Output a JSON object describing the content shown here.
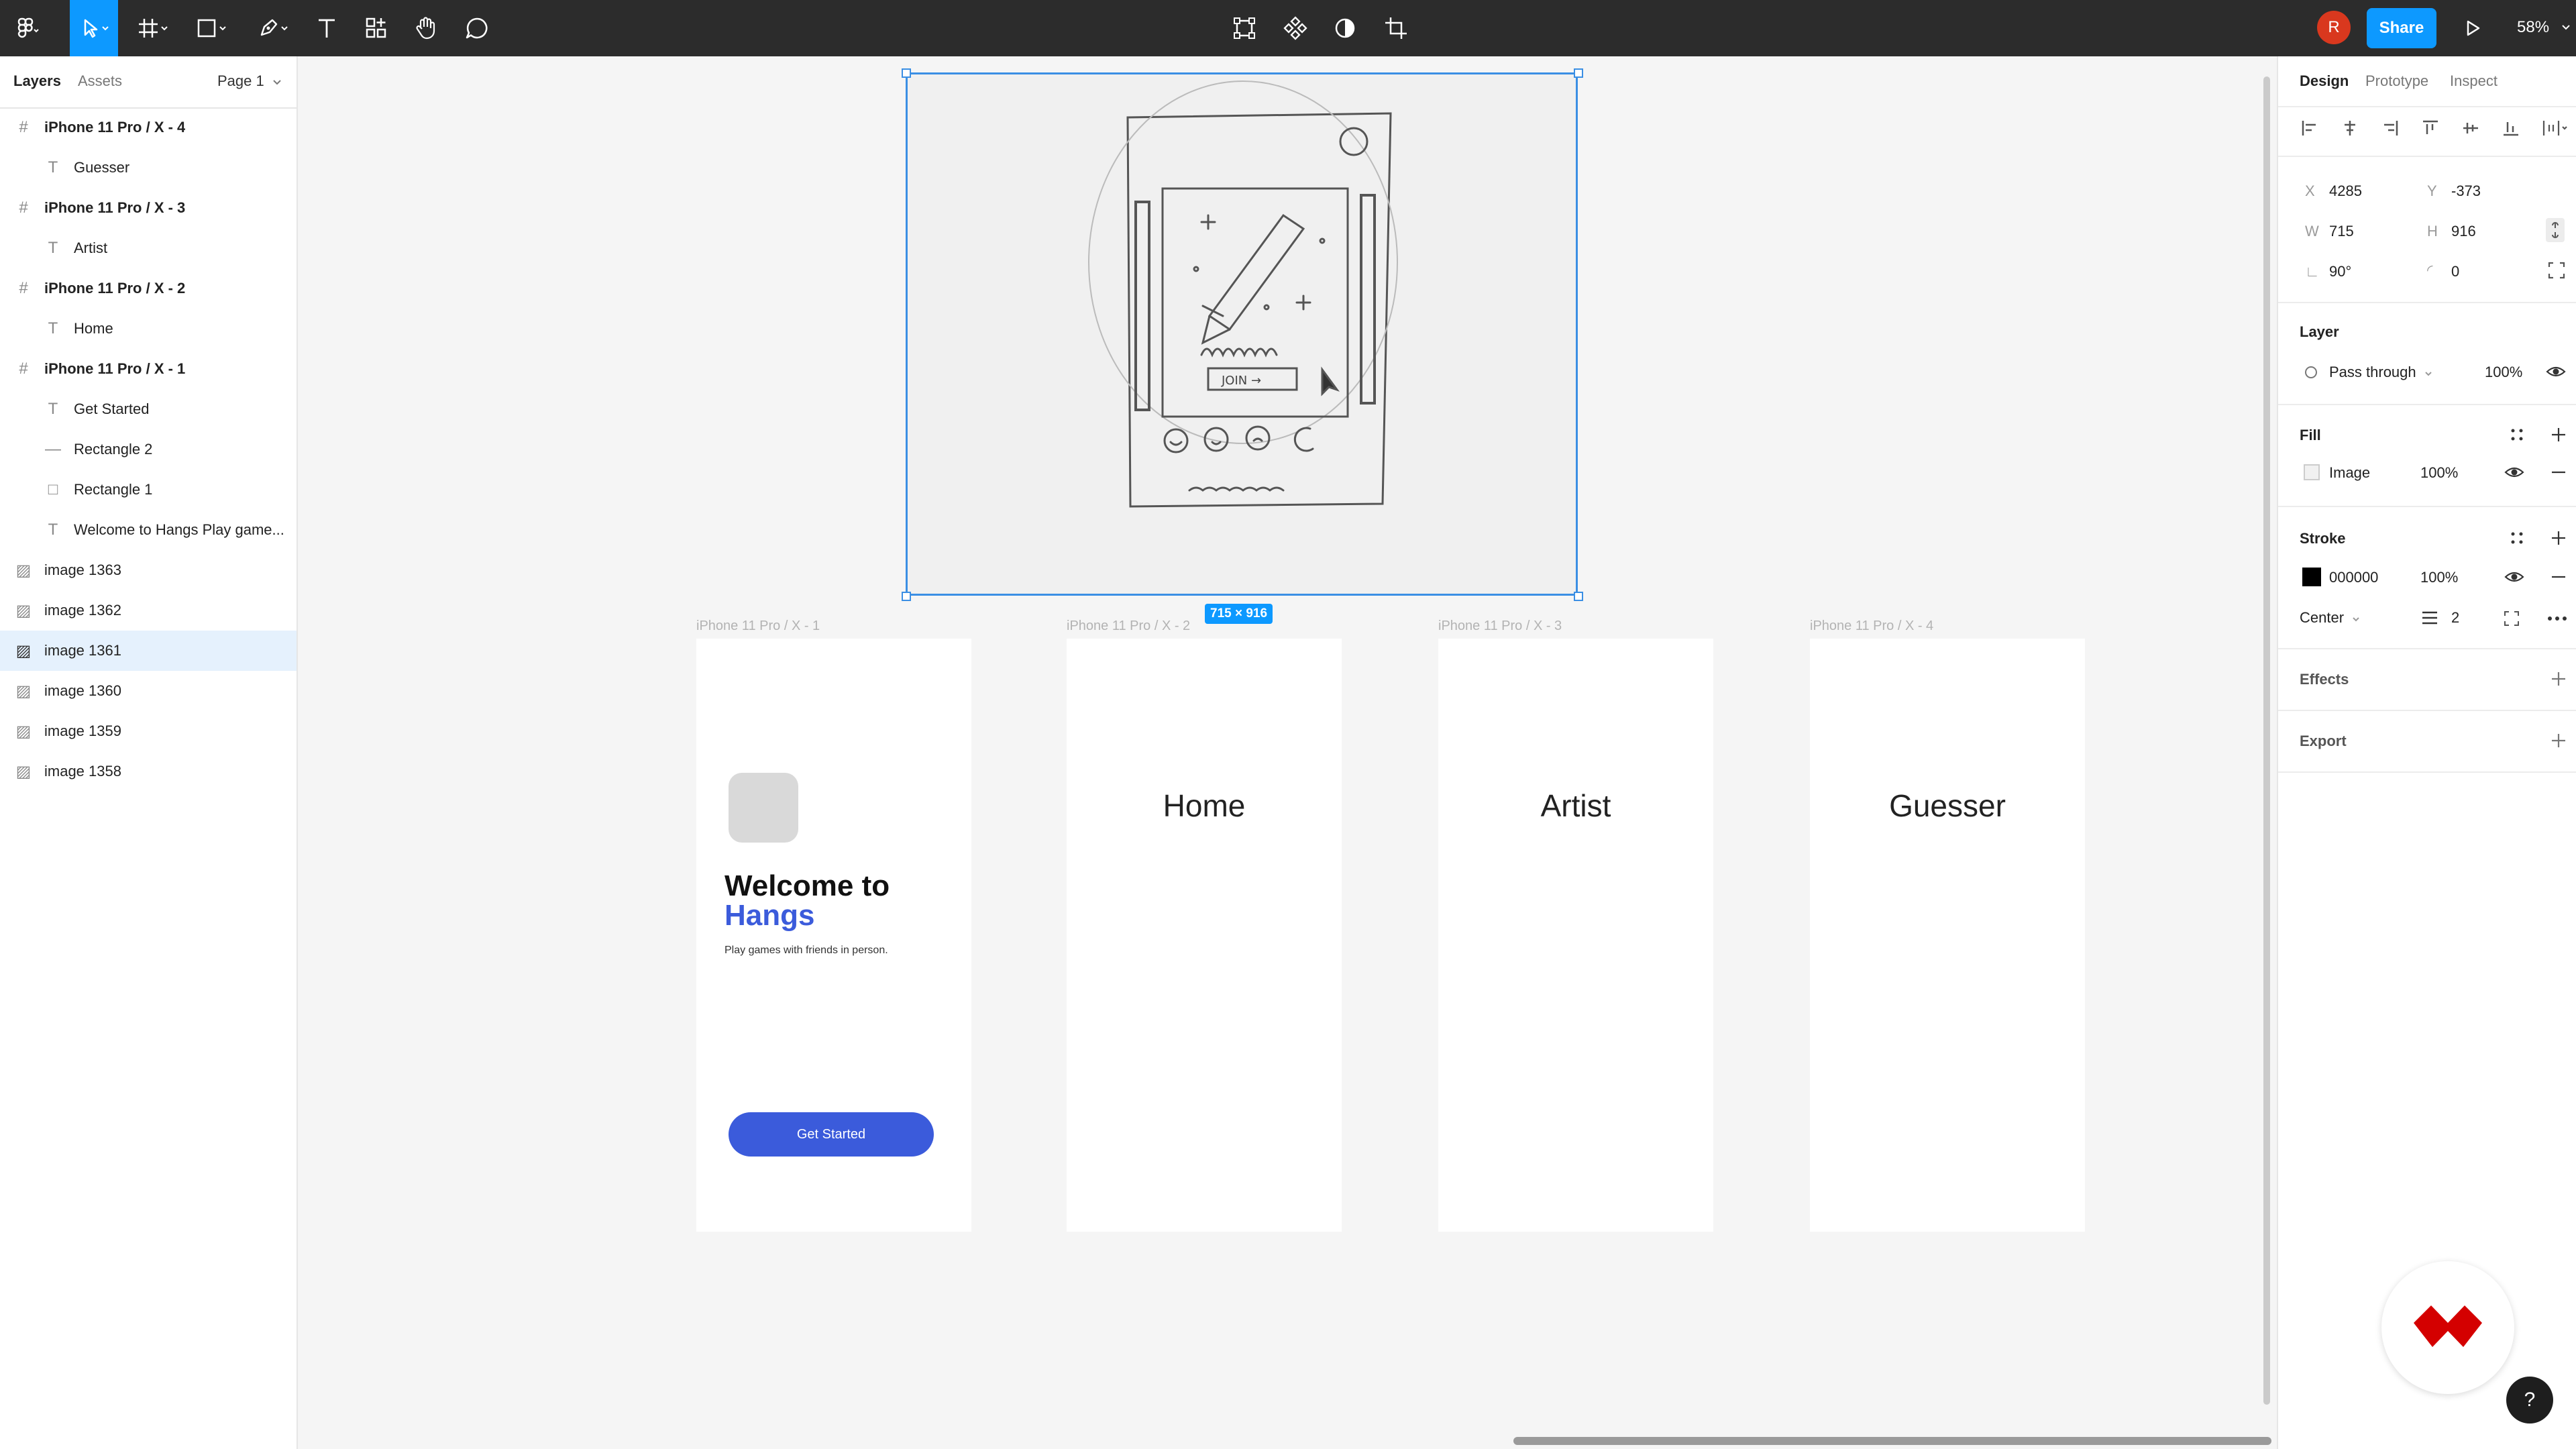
{
  "toolbar": {
    "share_label": "Share",
    "zoom_label": "58%",
    "avatar_initial": "R",
    "icons": [
      "figma-menu-icon",
      "move-tool-icon",
      "frame-tool-icon",
      "shape-tool-icon",
      "pen-tool-icon",
      "text-tool-icon",
      "resources-icon",
      "hand-tool-icon",
      "comment-icon",
      "edit-object-icon",
      "component-icon",
      "mask-icon",
      "crop-icon",
      "present-icon"
    ]
  },
  "left_panel": {
    "tabs": [
      "Layers",
      "Assets"
    ],
    "page_selector": "Page 1",
    "layers": [
      {
        "label": "iPhone 11 Pro / X - 4",
        "type": "frame",
        "indent": 0
      },
      {
        "label": "Guesser",
        "type": "text",
        "indent": 1
      },
      {
        "label": "iPhone 11 Pro / X - 3",
        "type": "frame",
        "indent": 0
      },
      {
        "label": "Artist",
        "type": "text",
        "indent": 1
      },
      {
        "label": "iPhone 11 Pro / X - 2",
        "type": "frame",
        "indent": 0
      },
      {
        "label": "Home",
        "type": "text",
        "indent": 1
      },
      {
        "label": "iPhone 11 Pro / X - 1",
        "type": "frame",
        "indent": 0
      },
      {
        "label": "Get Started",
        "type": "text",
        "indent": 1
      },
      {
        "label": "Rectangle 2",
        "type": "line",
        "indent": 1
      },
      {
        "label": "Rectangle 1",
        "type": "rect",
        "indent": 1
      },
      {
        "label": "Welcome to Hangs Play game...",
        "type": "text",
        "indent": 1
      },
      {
        "label": "image 1363",
        "type": "image",
        "indent": 0
      },
      {
        "label": "image 1362",
        "type": "image",
        "indent": 0
      },
      {
        "label": "image 1361",
        "type": "image",
        "indent": 0,
        "selected": true
      },
      {
        "label": "image 1360",
        "type": "image",
        "indent": 0
      },
      {
        "label": "image 1359",
        "type": "image",
        "indent": 0
      },
      {
        "label": "image 1358",
        "type": "image",
        "indent": 0
      }
    ]
  },
  "canvas": {
    "selection_size": "715 × 916",
    "sketch_join_text": "JOIN →",
    "frames": [
      {
        "label": "iPhone 11 Pro / X - 1",
        "title": ""
      },
      {
        "label": "iPhone 11 Pro / X - 2",
        "title": "Home"
      },
      {
        "label": "iPhone 11 Pro / X - 3",
        "title": "Artist"
      },
      {
        "label": "iPhone 11 Pro / X - 4",
        "title": "Guesser"
      }
    ],
    "welcome": {
      "line1": "Welcome to",
      "line2": "Hangs",
      "subtitle": "Play games with friends in person.",
      "button": "Get Started",
      "accent_color": "#3b5bdb"
    }
  },
  "right_panel": {
    "tabs": [
      "Design",
      "Prototype",
      "Inspect"
    ],
    "x_label": "X",
    "x_value": "4285",
    "y_label": "Y",
    "y_value": "-373",
    "w_label": "W",
    "w_value": "715",
    "h_label": "H",
    "h_value": "916",
    "rotation": "90°",
    "radius": "0",
    "layer": {
      "title": "Layer",
      "blend": "Pass through",
      "opacity": "100%"
    },
    "fill": {
      "title": "Fill",
      "type": "Image",
      "opacity": "100%"
    },
    "stroke": {
      "title": "Stroke",
      "color": "000000",
      "opacity": "100%",
      "position": "Center",
      "weight": "2"
    },
    "effects_title": "Effects",
    "export_title": "Export"
  },
  "help_label": "?"
}
